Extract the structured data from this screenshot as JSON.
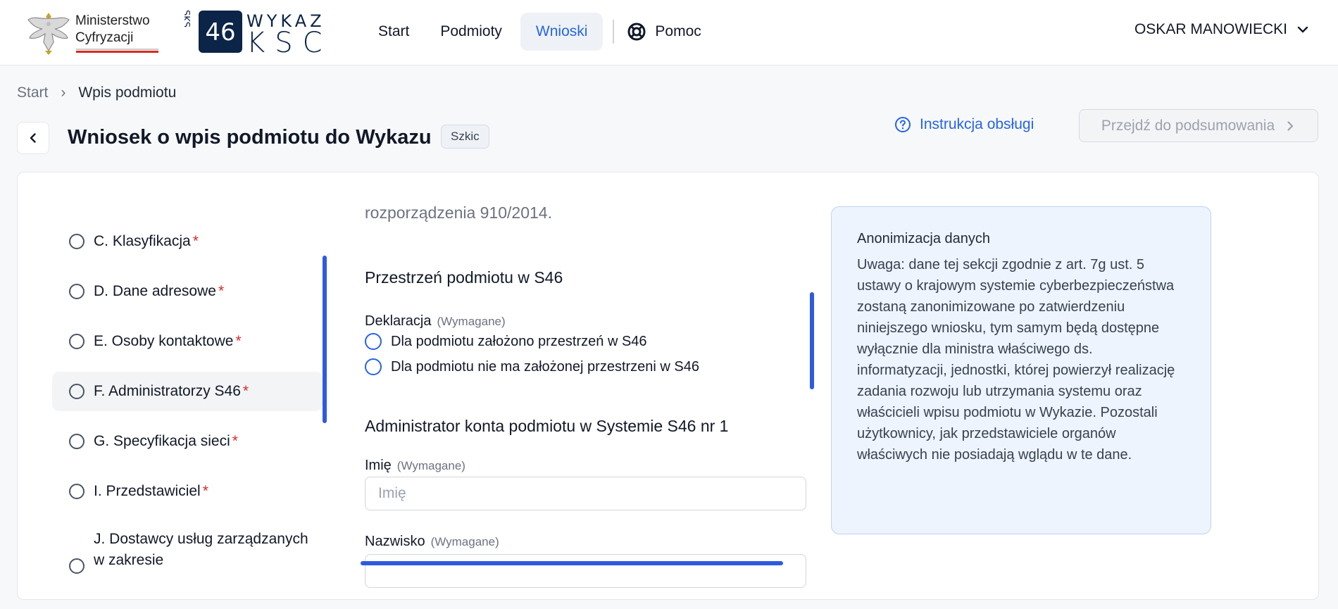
{
  "header": {
    "ministry_line1": "Ministerstwo",
    "ministry_line2": "Cyfryzacji",
    "nav": {
      "start": "Start",
      "entities": "Podmioty",
      "applications": "Wnioski",
      "help": "Pomoc"
    },
    "user_name": "OSKAR MANOWIECKI"
  },
  "breadcrumb": {
    "start": "Start",
    "separator": "›",
    "current": "Wpis podmiotu"
  },
  "title_bar": {
    "title": "Wniosek o wpis podmiotu do Wykazu",
    "status_badge": "Szkic",
    "instructions_link": "Instrukcja obsługi",
    "summary_button": "Przejdź do podsumowania"
  },
  "steps": [
    {
      "label": "C. Klasyfikacja",
      "required": "*"
    },
    {
      "label": "D. Dane adresowe",
      "required": "*"
    },
    {
      "label": "E. Osoby kontaktowe",
      "required": "*"
    },
    {
      "label": "F. Administratorzy S46",
      "required": "*"
    },
    {
      "label": "G. Specyfikacja sieci",
      "required": "*"
    },
    {
      "label": "I. Przedstawiciel",
      "required": "*"
    },
    {
      "label": "J. Dostawcy usług zarządzanych w zakresie",
      "required": ""
    }
  ],
  "form": {
    "fragment_text": "rozporządzenia 910/2014.",
    "space_section_title": "Przestrzeń podmiotu w S46",
    "declaration_label": "Deklaracja",
    "required_hint": "(Wymagane)",
    "declaration_options": [
      "Dla podmiotu założono przestrzeń w S46",
      "Dla podmiotu nie ma założonej przestrzeni w S46"
    ],
    "admin_section_title": "Administrator konta podmiotu w Systemie S46 nr 1",
    "first_name_label": "Imię",
    "first_name_placeholder": "Imię",
    "last_name_label": "Nazwisko"
  },
  "info_box": {
    "title": "Anonimizacja danych",
    "body": "Uwaga: dane tej sekcji zgodnie z art. 7g ust. 5 ustawy o krajowym systemie cyberbezpieczeństwa zostaną zanonimizowane po zatwierdzeniu niniejszego wniosku, tym samym będą dostępne wyłącznie dla ministra właściwego ds. informatyzacji, jednostki, której powierzył realizację zadania rozwoju lub utrzymania systemu oraz właścicieli wpisu podmiotu w Wykazie. Pozostali użytkownicy, jak przedstawiciele organów właściwych nie posiadają wglądu w te dane."
  },
  "colors": {
    "accent": "#2563eb",
    "scrollbar": "#2f5ae0",
    "required": "#dc2626",
    "info_bg": "#eef4fd"
  },
  "icons": [
    "eagle-emblem-icon",
    "s46-wykaz-ksc-logo",
    "lifebuoy-icon",
    "chevron-down-icon",
    "chevron-left-icon",
    "question-circle-icon",
    "chevron-right-icon"
  ]
}
